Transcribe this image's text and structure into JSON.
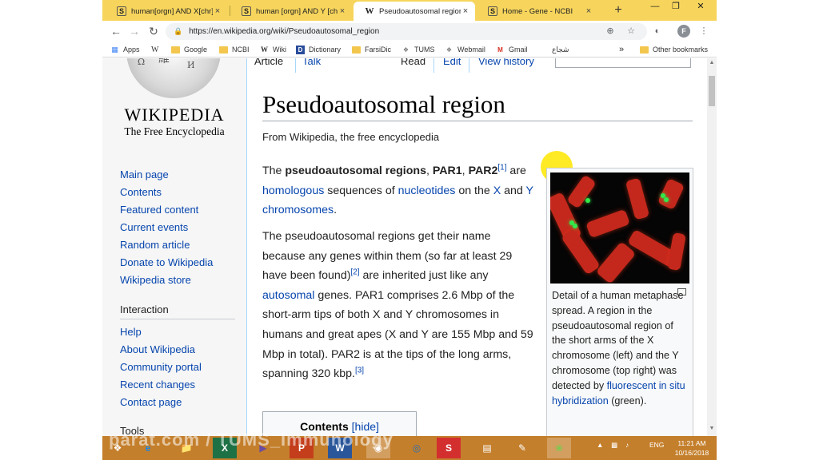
{
  "browser": {
    "tabs": [
      {
        "title": "human[orgn] AND X[chr] ...",
        "close": "×"
      },
      {
        "title": "human [orgn] AND Y [chr] ...",
        "close": "×"
      },
      {
        "title": "Pseudoautosomal region - Wiki...",
        "close": "×"
      },
      {
        "title": "Home - Gene - NCBI",
        "close": "×"
      }
    ],
    "new_tab": "+",
    "url": "https://en.wikipedia.org/wiki/Pseudoautosomal_region",
    "profile_initial": "F"
  },
  "bookmarks": {
    "items": [
      "Apps",
      "W",
      "Google",
      "NCBI",
      "Wiki",
      "Dictionary",
      "FarsiDic",
      "TUMS",
      "Webmail",
      "Gmail",
      "شجاع"
    ],
    "overflow": "»",
    "other": "Other bookmarks"
  },
  "wiki": {
    "wordmark": "WIKIPEDIA",
    "tagline": "The Free Encyclopedia",
    "nav": [
      "Main page",
      "Contents",
      "Featured content",
      "Current events",
      "Random article",
      "Donate to Wikipedia",
      "Wikipedia store"
    ],
    "interaction_heading": "Interaction",
    "interaction": [
      "Help",
      "About Wikipedia",
      "Community portal",
      "Recent changes",
      "Contact page"
    ],
    "tools_heading": "Tools",
    "top_tabs": [
      "Article",
      "Talk",
      "Read",
      "Edit",
      "View history"
    ]
  },
  "article": {
    "title": "Pseudoautosomal region",
    "from": "From Wikipedia, the free encyclopedia",
    "p1": {
      "t1": "The ",
      "b1": "pseudoautosomal regions",
      "t2": ", ",
      "b2": "PAR1",
      "t3": ", ",
      "b3": "PAR2",
      "ref": "[1]",
      "t4": " are ",
      "l1": "homologous",
      "t5": " sequences of ",
      "l2": "nucleotides",
      "t6": " on the ",
      "l3": "X",
      "t7": " and ",
      "l4": "Y",
      "t8": " ",
      "l5": "chromosomes",
      "t9": "."
    },
    "p2": {
      "t1": "The pseudoautosomal regions get their name because any genes within them (so far at least 29 have been found)",
      "ref2": "[2]",
      "t2": " are inherited just like any ",
      "l1": "autosomal",
      "t3": " genes. PAR1 comprises 2.6 Mbp of the short-arm tips of both X and Y chromosomes in humans and great apes (X and Y are 155 Mbp and 59 Mbp in total). PAR2 is at the tips of the long arms, spanning 320 kbp.",
      "ref3": "[3]"
    },
    "toc": {
      "title": "Contents",
      "hide": "[hide]"
    },
    "caption": {
      "text": "Detail of a human metaphase spread. A region in the pseudoautosomal region of the short arms of the X chromosome (left) and the Y chromosome (top right) was detected by ",
      "link": "fluorescent in situ hybridization",
      "end": " (green)."
    }
  },
  "taskbar": {
    "watermark": "parat.com / TUMS_Immunology",
    "lang": "ENG",
    "time": "11:21 AM",
    "date": "10/16/2018"
  }
}
